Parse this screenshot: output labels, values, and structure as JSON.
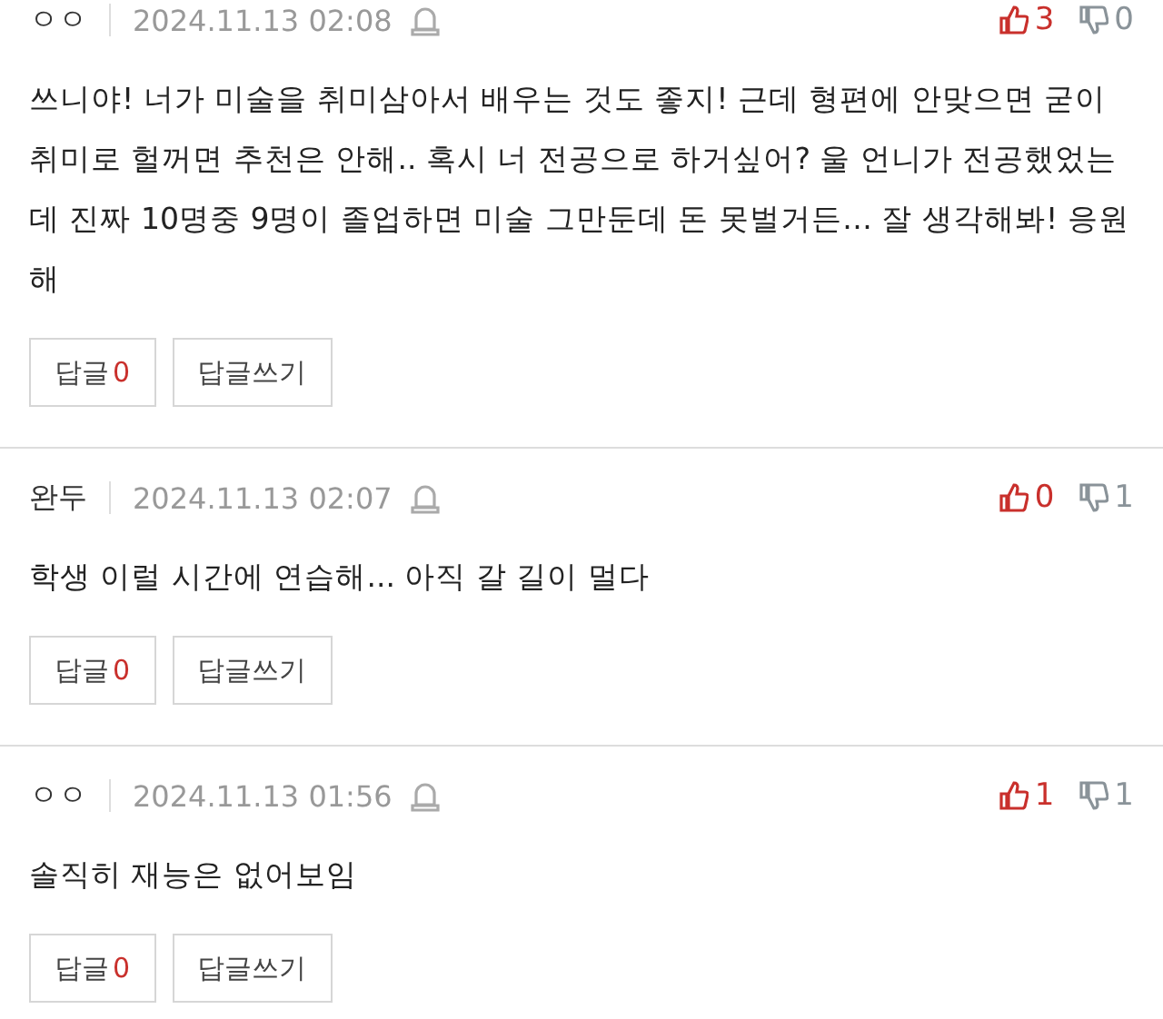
{
  "comments": [
    {
      "author": "ㅇㅇ",
      "date": "2024.11.13 02:08",
      "likes": "3",
      "dislikes": "0",
      "text": "쓰니야! 너가 미술을 취미삼아서 배우는 것도 좋지! 근데 형편에 안맞으면 굳이 취미로 헐꺼면 추천은 안해.. 혹시 너 전공으로 하거싶어? 울 언니가 전공했었는데 진짜 10명중 9명이 졸업하면 미술 그만둔데 돈 못벌거든… 잘 생각해봐! 응원해",
      "reply_label": "답글",
      "reply_count": "0",
      "write_label": "답글쓰기"
    },
    {
      "author": "완두",
      "date": "2024.11.13 02:07",
      "likes": "0",
      "dislikes": "1",
      "text": "학생 이럴 시간에 연습해... 아직 갈 길이 멀다",
      "reply_label": "답글",
      "reply_count": "0",
      "write_label": "답글쓰기"
    },
    {
      "author": "ㅇㅇ",
      "date": "2024.11.13 01:56",
      "likes": "1",
      "dislikes": "1",
      "text": "솔직히 재능은 없어보임",
      "reply_label": "답글",
      "reply_count": "0",
      "write_label": "답글쓰기"
    }
  ]
}
